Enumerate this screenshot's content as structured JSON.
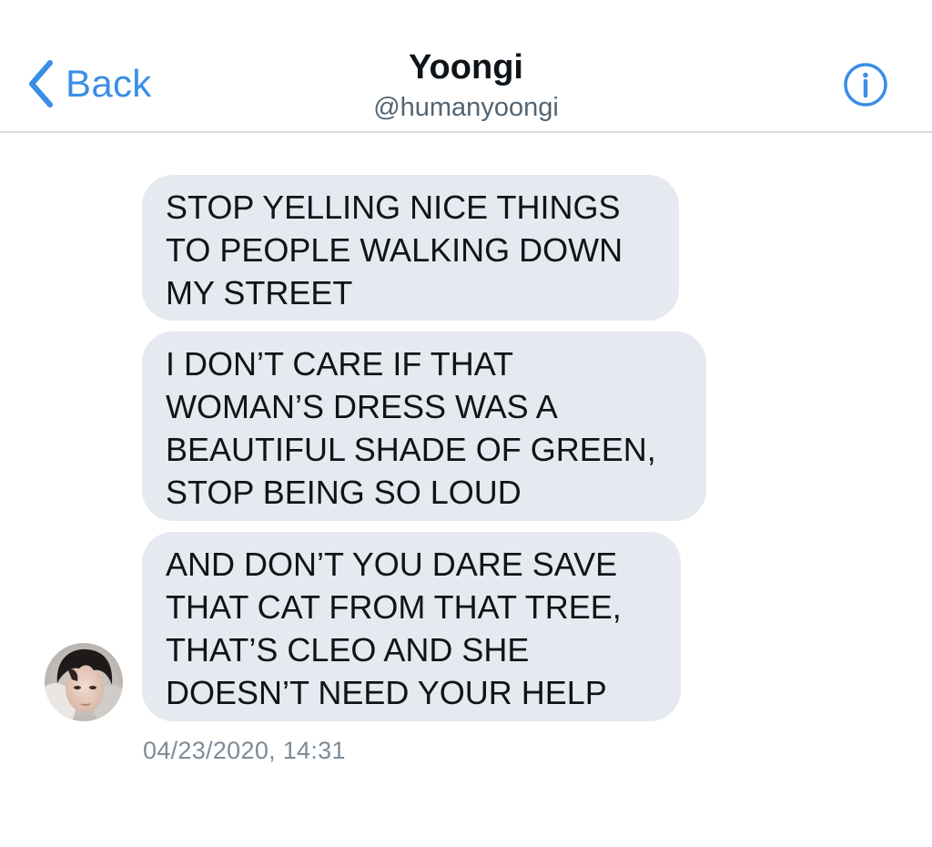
{
  "header": {
    "back_label": "Back",
    "contact_name": "Yoongi",
    "contact_handle": "@humanyoongi",
    "info_icon": "info-icon",
    "accent_color": "#3a8ee6"
  },
  "messages": [
    {
      "text": "STOP YELLING NICE THINGS\nTO PEOPLE WALKING DOWN\nMY STREET"
    },
    {
      "text": "I DON’T CARE IF THAT\nWOMAN’S DRESS WAS A\nBEAUTIFUL SHADE OF GREEN,\nSTOP BEING SO LOUD"
    },
    {
      "text": "AND DON’T YOU DARE SAVE\nTHAT CAT FROM THAT TREE,\nTHAT’S CLEO AND SHE\nDOESN’T NEED YOUR HELP"
    }
  ],
  "timestamp": "04/23/2020, 14:31",
  "colors": {
    "bubble_bg": "#e6e9ef",
    "text": "#0f1419",
    "muted": "#7f8b95",
    "divider": "#d6d9dd"
  }
}
